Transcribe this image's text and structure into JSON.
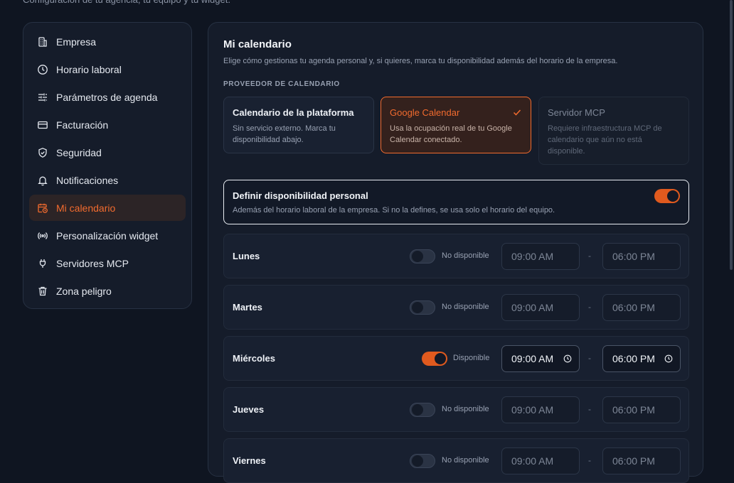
{
  "page": {
    "subtitle": "Configuración de tu agencia, tu equipo y tu widget."
  },
  "sidebar": {
    "items": [
      {
        "label": "Empresa",
        "icon": "building-icon"
      },
      {
        "label": "Horario laboral",
        "icon": "clock-icon"
      },
      {
        "label": "Parámetros de agenda",
        "icon": "sliders-icon"
      },
      {
        "label": "Facturación",
        "icon": "credit-card-icon"
      },
      {
        "label": "Seguridad",
        "icon": "shield-check-icon"
      },
      {
        "label": "Notificaciones",
        "icon": "bell-icon"
      },
      {
        "label": "Mi calendario",
        "icon": "calendar-clock-icon",
        "active": true
      },
      {
        "label": "Personalización widget",
        "icon": "broadcast-icon"
      },
      {
        "label": "Servidores MCP",
        "icon": "plug-icon"
      },
      {
        "label": "Zona peligro",
        "icon": "trash-icon"
      }
    ]
  },
  "main": {
    "title": "Mi calendario",
    "description": "Elige cómo gestionas tu agenda personal y, si quieres, marca tu disponibilidad además del horario de la empresa.",
    "provider_label": "PROVEEDOR DE CALENDARIO",
    "providers": [
      {
        "title": "Calendario de la plataforma",
        "desc": "Sin servicio externo. Marca tu disponibilidad abajo."
      },
      {
        "title": "Google Calendar",
        "desc": "Usa la ocupación real de tu Google Calendar conectado.",
        "selected": true
      },
      {
        "title": "Servidor MCP",
        "desc": "Requiere infraestructura MCP de calendario que aún no está disponible.",
        "disabled": true
      }
    ],
    "personal": {
      "title": "Definir disponibilidad personal",
      "desc": "Además del horario laboral de la empresa. Si no la defines, se usa solo el horario del equipo.",
      "enabled": true
    },
    "days": [
      {
        "name": "Lunes",
        "status": "No disponible",
        "start": "09:00 AM",
        "end": "06:00 PM",
        "available": false
      },
      {
        "name": "Martes",
        "status": "No disponible",
        "start": "09:00 AM",
        "end": "06:00 PM",
        "available": false
      },
      {
        "name": "Miércoles",
        "status": "Disponible",
        "start": "09:00 AM",
        "end": "06:00 PM",
        "available": true
      },
      {
        "name": "Jueves",
        "status": "No disponible",
        "start": "09:00 AM",
        "end": "06:00 PM",
        "available": false
      },
      {
        "name": "Viernes",
        "status": "No disponible",
        "start": "09:00 AM",
        "end": "06:00 PM",
        "available": false
      }
    ],
    "separator": "-"
  },
  "colors": {
    "accent": "#f26b2e",
    "background": "#0f1521",
    "panel": "#151c2a"
  }
}
